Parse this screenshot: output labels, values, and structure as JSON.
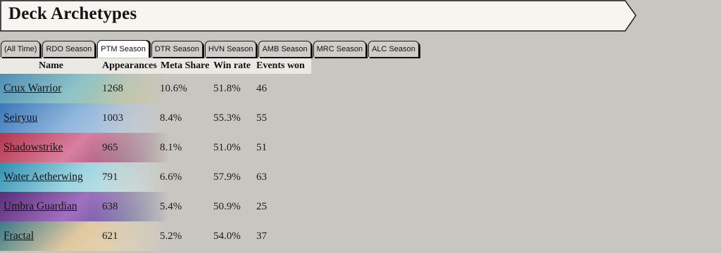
{
  "header": {
    "title": "Deck Archetypes"
  },
  "tabs": [
    {
      "label": "(All Time)",
      "active": false
    },
    {
      "label": "RDO Season",
      "active": false
    },
    {
      "label": "PTM Season",
      "active": true
    },
    {
      "label": "DTR Season",
      "active": false
    },
    {
      "label": "HVN Season",
      "active": false
    },
    {
      "label": "AMB Season",
      "active": false
    },
    {
      "label": "MRC Season",
      "active": false
    },
    {
      "label": "ALC Season",
      "active": false
    }
  ],
  "table": {
    "columns": [
      "Name",
      "Appearances",
      "Meta Share",
      "Win rate",
      "Events won"
    ],
    "rows": [
      {
        "name": "Crux Warrior",
        "appearances": "1268",
        "meta_share": "10.6%",
        "win_rate": "51.8%",
        "events_won": "46",
        "art_colors": [
          "#4e8fb4",
          "#8fc3c9",
          "#d8c880"
        ]
      },
      {
        "name": "Seiryuu",
        "appearances": "1003",
        "meta_share": "8.4%",
        "win_rate": "55.3%",
        "events_won": "55",
        "art_colors": [
          "#3a78b8",
          "#92b7dc",
          "#cfd8e8"
        ]
      },
      {
        "name": "Shadowstrike",
        "appearances": "965",
        "meta_share": "8.1%",
        "win_rate": "51.0%",
        "events_won": "51",
        "art_colors": [
          "#b2384f",
          "#d97fa0",
          "#6a3a5e"
        ]
      },
      {
        "name": "Water Aetherwing",
        "appearances": "791",
        "meta_share": "6.6%",
        "win_rate": "57.9%",
        "events_won": "63",
        "art_colors": [
          "#2f8fb0",
          "#9ed4df",
          "#e6f2f4"
        ]
      },
      {
        "name": "Umbra Guardian",
        "appearances": "638",
        "meta_share": "5.4%",
        "win_rate": "50.9%",
        "events_won": "25",
        "art_colors": [
          "#5a2e78",
          "#a070c0",
          "#3a4a8a"
        ]
      },
      {
        "name": "Fractal",
        "appearances": "621",
        "meta_share": "5.2%",
        "win_rate": "54.0%",
        "events_won": "37",
        "art_colors": [
          "#3a7a8a",
          "#e0c8a0",
          "#f0e0c0"
        ]
      }
    ]
  }
}
